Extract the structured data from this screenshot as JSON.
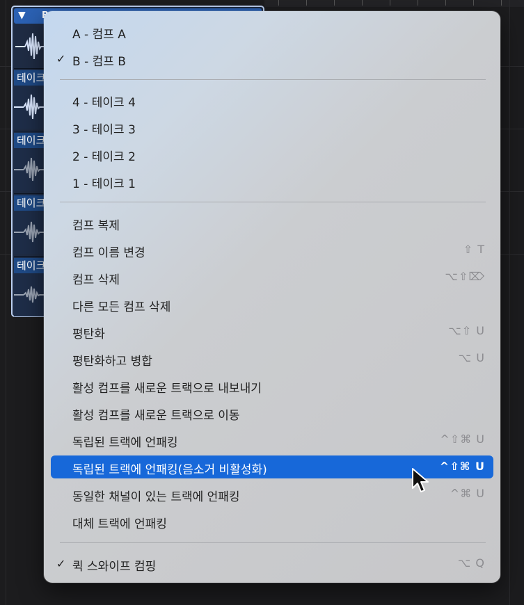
{
  "take_folder": {
    "header_letter": "B",
    "takes": [
      {
        "label": "테이크"
      },
      {
        "label": "테이크"
      },
      {
        "label": "테이크"
      },
      {
        "label": "테이크"
      }
    ]
  },
  "menu": {
    "items": [
      {
        "label": "A - 컴프 A",
        "checked": false,
        "shortcut": ""
      },
      {
        "label": "B - 컴프 B",
        "checked": true,
        "shortcut": ""
      },
      {
        "label": "4 - 테이크 4",
        "checked": false,
        "shortcut": ""
      },
      {
        "label": "3 - 테이크 3",
        "checked": false,
        "shortcut": ""
      },
      {
        "label": "2 - 테이크 2",
        "checked": false,
        "shortcut": ""
      },
      {
        "label": "1 - 테이크 1",
        "checked": false,
        "shortcut": ""
      },
      {
        "label": "컴프 복제",
        "checked": false,
        "shortcut": ""
      },
      {
        "label": "컴프 이름 변경",
        "checked": false,
        "shortcut": "⇧ T"
      },
      {
        "label": "컴프 삭제",
        "checked": false,
        "shortcut": "⌥⇧⌦"
      },
      {
        "label": "다른 모든 컴프 삭제",
        "checked": false,
        "shortcut": ""
      },
      {
        "label": "평탄화",
        "checked": false,
        "shortcut": "⌥⇧ U"
      },
      {
        "label": "평탄화하고 병합",
        "checked": false,
        "shortcut": "⌥ U"
      },
      {
        "label": "활성 컴프를 새로운 트랙으로 내보내기",
        "checked": false,
        "shortcut": ""
      },
      {
        "label": "활성 컴프를 새로운 트랙으로 이동",
        "checked": false,
        "shortcut": ""
      },
      {
        "label": "독립된 트랙에 언패킹",
        "checked": false,
        "shortcut": "^⇧⌘ U"
      },
      {
        "label": "독립된 트랙에 언패킹(음소거 비활성화)",
        "checked": false,
        "shortcut": "^⇧⌘ U",
        "highlighted": true
      },
      {
        "label": "동일한 채널이 있는 트랙에 언패킹",
        "checked": false,
        "shortcut": "^⌘ U"
      },
      {
        "label": "대체 트랙에 언패킹",
        "checked": false,
        "shortcut": ""
      },
      {
        "label": "퀵 스와이프 컴핑",
        "checked": true,
        "shortcut": "⌥ Q"
      }
    ],
    "check_glyph": "✓"
  },
  "colors": {
    "highlight": "#1768d9",
    "take_label_bg": "#1f4a86",
    "folder_header": "#2b61b3",
    "folder_border": "#bcd0f0"
  }
}
